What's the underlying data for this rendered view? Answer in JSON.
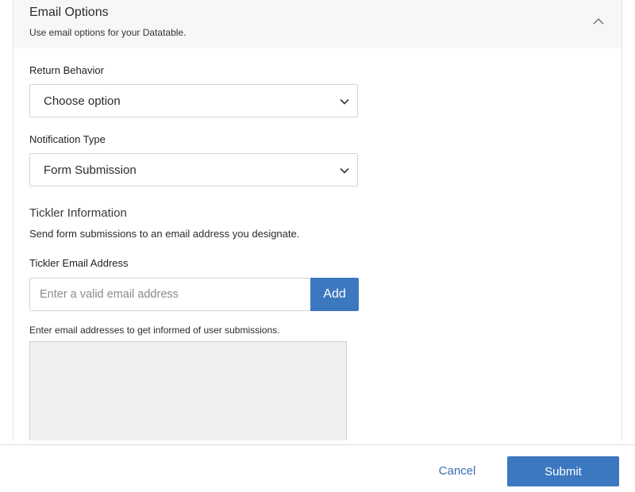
{
  "header": {
    "title": "Email Options",
    "subtitle": "Use email options for your Datatable.",
    "toggle_icon": "chevron-up-icon"
  },
  "return_behavior": {
    "label": "Return Behavior",
    "value": "Choose option",
    "icon": "chevron-down-icon"
  },
  "notification_type": {
    "label": "Notification Type",
    "value": "Form Submission",
    "icon": "chevron-down-icon"
  },
  "tickler": {
    "title": "Tickler Information",
    "description": "Send form submissions to an email address you designate.",
    "email_label": "Tickler Email Address",
    "email_placeholder": "Enter a valid email address",
    "email_value": "",
    "add_label": "Add",
    "helper_text": "Enter email addresses to get informed of user submissions."
  },
  "footer": {
    "cancel_label": "Cancel",
    "submit_label": "Submit"
  },
  "colors": {
    "primary": "#3c78c0",
    "link": "#3c6fb0",
    "header_bg": "#f7f7f7",
    "list_bg": "#f0f0f0"
  }
}
